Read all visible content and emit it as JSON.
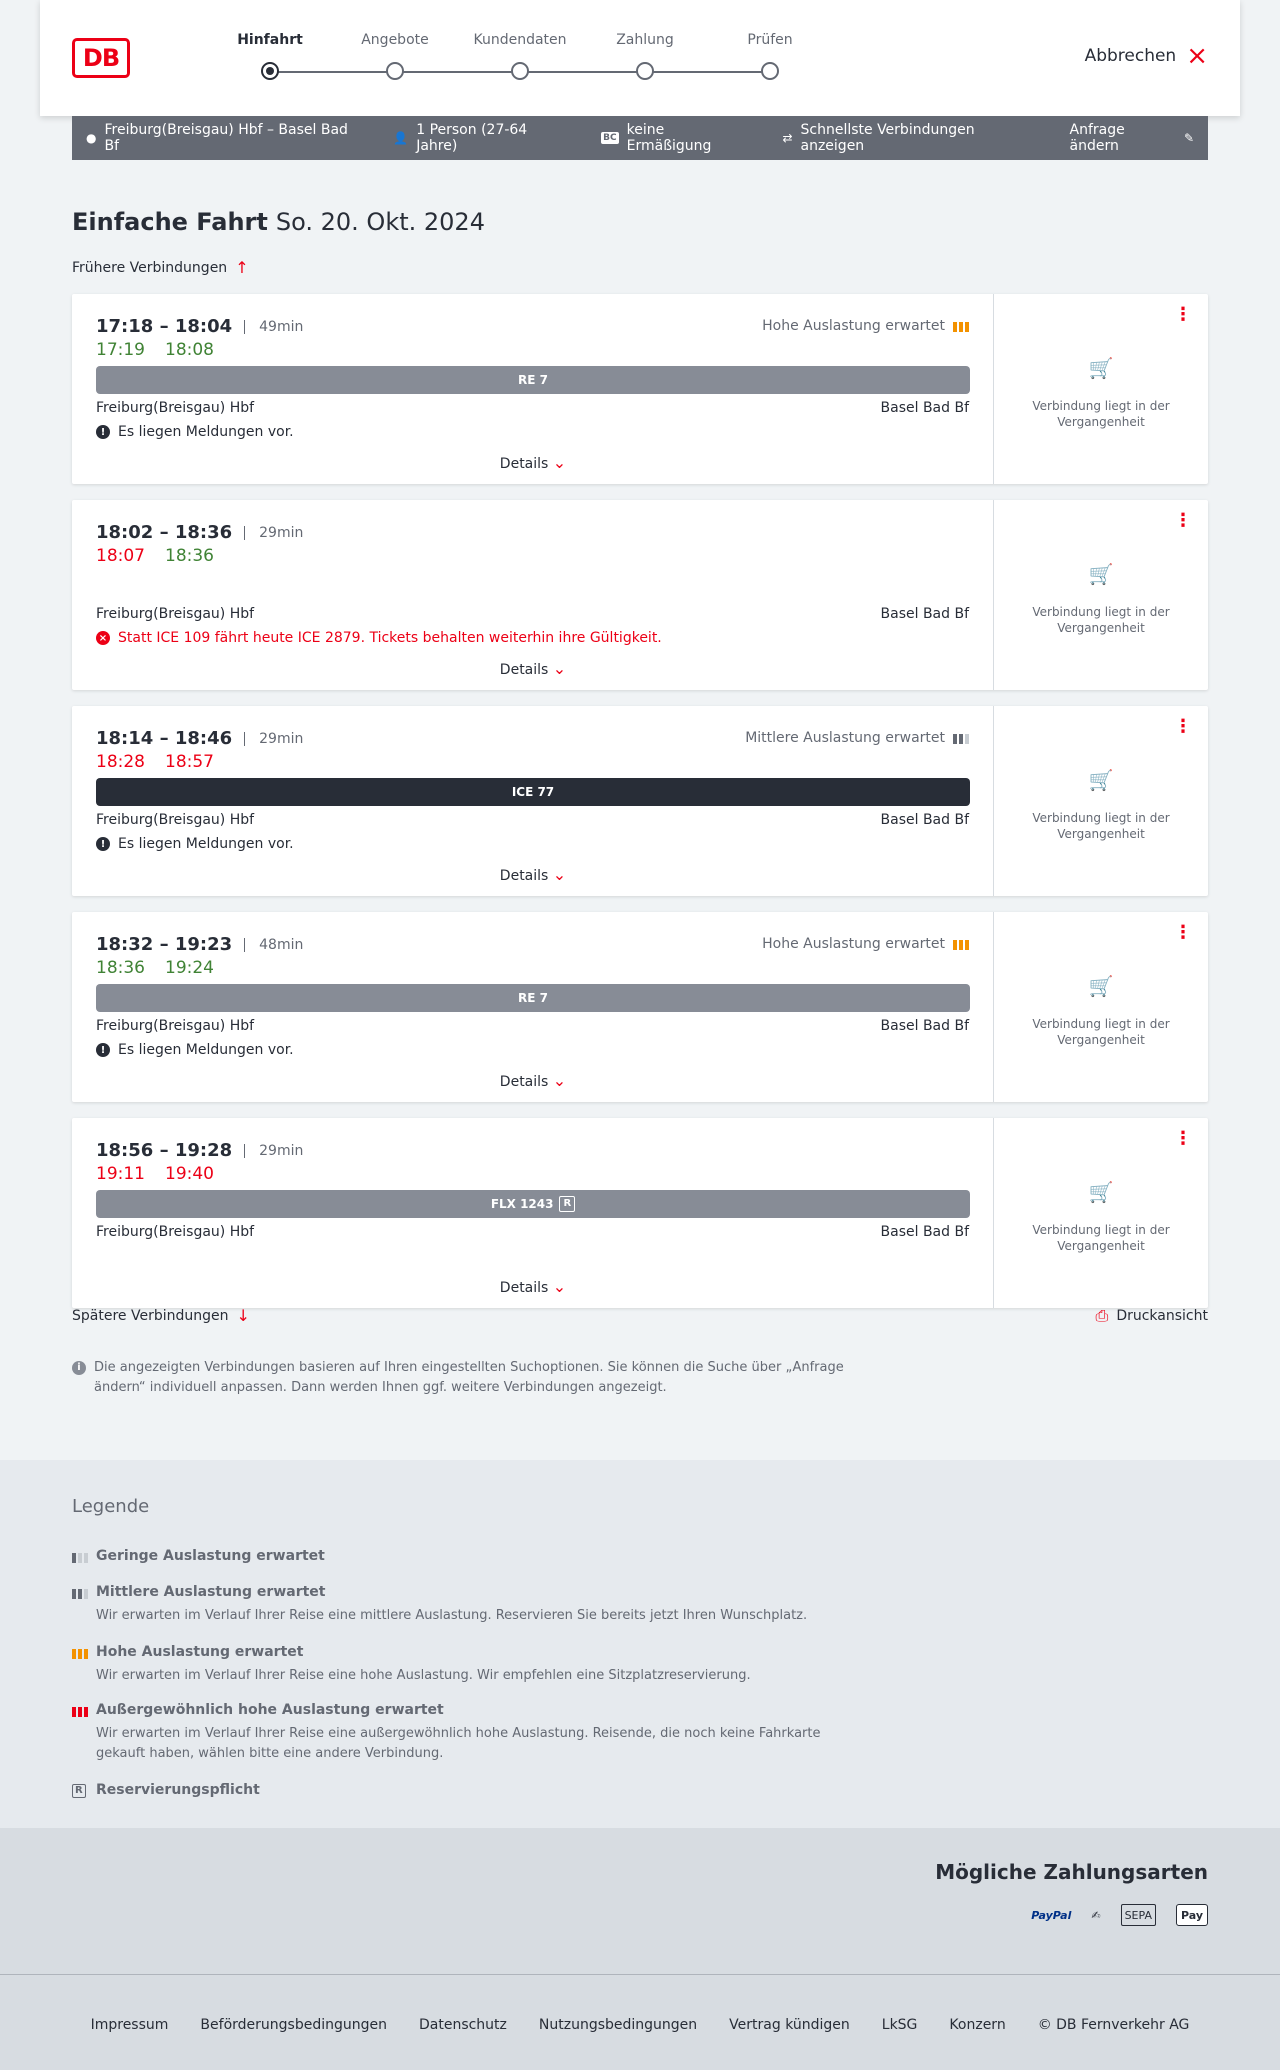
{
  "header": {
    "logo": "DB",
    "steps": [
      "Hinfahrt",
      "Angebote",
      "Kundendaten",
      "Zahlung",
      "Prüfen"
    ],
    "active_step": 0,
    "abort_label": "Abbrechen"
  },
  "filter": {
    "route": "Freiburg(Breisgau) Hbf – Basel Bad Bf",
    "persons": "1 Person (27-64 Jahre)",
    "bahncard_icon": "BC",
    "discount": "keine Ermäßigung",
    "fastest": "Schnellste Verbindungen anzeigen",
    "change": "Anfrage ändern"
  },
  "trip": {
    "type": "Einfache Fahrt",
    "date": "So. 20. Okt. 2024",
    "earlier": "Frühere Verbindungen",
    "later": "Spätere Verbindungen",
    "print": "Druckansicht",
    "details_label": "Details",
    "past_label": "Verbindung liegt in der Vergangenheit"
  },
  "connections": [
    {
      "times": "17:18 – 18:04",
      "duration": "49min",
      "rt_dep": "17:19",
      "rt_arr": "18:08",
      "dep_status": "ontime",
      "arr_status": "ontime",
      "load": "Hohe Auslastung erwartet",
      "load_level": "high",
      "train": "RE 7",
      "train_style": "grey",
      "from": "Freiburg(Breisgau) Hbf",
      "to": "Basel Bad Bf",
      "message": "Es liegen Meldungen vor.",
      "message_type": "info"
    },
    {
      "times": "18:02 – 18:36",
      "duration": "29min",
      "rt_dep": "18:07",
      "rt_arr": "18:36",
      "dep_status": "late",
      "arr_status": "ontime",
      "load": "",
      "load_level": "",
      "train": "",
      "train_style": "",
      "from": "Freiburg(Breisgau) Hbf",
      "to": "Basel Bad Bf",
      "message": "Statt ICE 109 fährt heute ICE 2879. Tickets behalten weiterhin ihre Gültigkeit.",
      "message_type": "error"
    },
    {
      "times": "18:14 – 18:46",
      "duration": "29min",
      "rt_dep": "18:28",
      "rt_arr": "18:57",
      "dep_status": "late",
      "arr_status": "late",
      "load": "Mittlere Auslastung erwartet",
      "load_level": "medium",
      "train": "ICE 77",
      "train_style": "dark",
      "from": "Freiburg(Breisgau) Hbf",
      "to": "Basel Bad Bf",
      "message": "Es liegen Meldungen vor.",
      "message_type": "info"
    },
    {
      "times": "18:32 – 19:23",
      "duration": "48min",
      "rt_dep": "18:36",
      "rt_arr": "19:24",
      "dep_status": "ontime",
      "arr_status": "ontime",
      "load": "Hohe Auslastung erwartet",
      "load_level": "high",
      "train": "RE 7",
      "train_style": "grey",
      "from": "Freiburg(Breisgau) Hbf",
      "to": "Basel Bad Bf",
      "message": "Es liegen Meldungen vor.",
      "message_type": "info"
    },
    {
      "times": "18:56 – 19:28",
      "duration": "29min",
      "rt_dep": "19:11",
      "rt_arr": "19:40",
      "dep_status": "late",
      "arr_status": "late",
      "load": "",
      "load_level": "",
      "train": "FLX 1243",
      "train_style": "grey",
      "train_badge": "R",
      "from": "Freiburg(Breisgau) Hbf",
      "to": "Basel Bad Bf",
      "message": "",
      "message_type": ""
    }
  ],
  "info_text": "Die angezeigten Verbindungen basieren auf Ihren eingestellten Suchoptionen. Sie können die Suche über „Anfrage ändern“ individuell anpassen. Dann werden Ihnen ggf. weitere Verbindungen angezeigt.",
  "legend": {
    "title": "Legende",
    "items": [
      {
        "title": "Geringe Auslastung erwartet",
        "desc": "",
        "icon": "load-low-icon"
      },
      {
        "title": "Mittlere Auslastung erwartet",
        "desc": "Wir erwarten im Verlauf Ihrer Reise eine mittlere Auslastung. Reservieren Sie bereits jetzt Ihren Wunschplatz.",
        "icon": "load-medium-icon"
      },
      {
        "title": "Hohe Auslastung erwartet",
        "desc": "Wir erwarten im Verlauf Ihrer Reise eine hohe Auslastung. Wir empfehlen eine Sitzplatzreservierung.",
        "icon": "load-high-icon"
      },
      {
        "title": "Außergewöhnlich hohe Auslastung erwartet",
        "desc": "Wir erwarten im Verlauf Ihrer Reise eine außergewöhnlich hohe Auslastung. Reisende, die noch keine Fahrkarte gekauft haben, wählen bitte eine andere Verbindung.",
        "icon": "load-extreme-icon"
      },
      {
        "title": "Reservierungspflicht",
        "desc": "",
        "icon": "reservation-required-icon"
      }
    ]
  },
  "payment": {
    "title": "Mögliche Zahlungsarten",
    "paypal": "PayPal",
    "sepa": "SEPA",
    "applepay": "Pay"
  },
  "footer": [
    "Impressum",
    "Beförderungsbedingungen",
    "Datenschutz",
    "Nutzungsbedingungen",
    "Vertrag kündigen",
    "LkSG",
    "Konzern",
    "© DB Fernverkehr AG"
  ],
  "colors": {
    "brand_red": "#ec0016",
    "ontime": "#408335",
    "load_high": "#f39200",
    "bar_grey": "#878c96",
    "bar_dark": "#282d37"
  }
}
